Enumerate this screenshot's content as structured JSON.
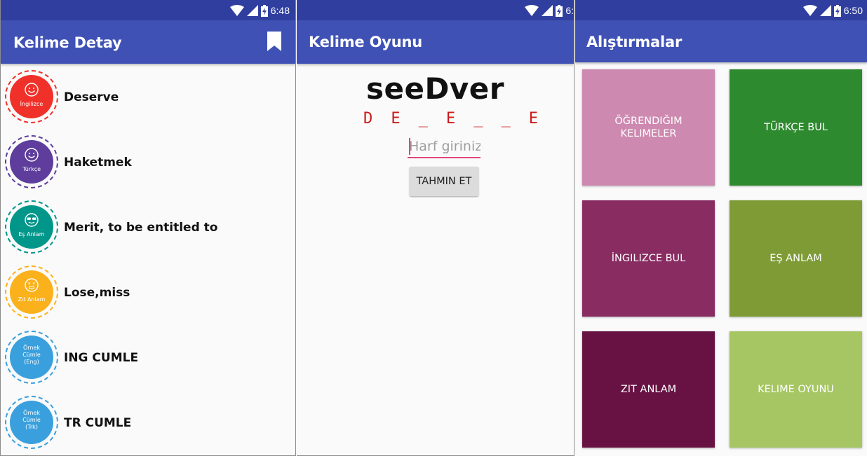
{
  "screens": {
    "detail": {
      "status_time": "6:48",
      "title": "Kelime Detay",
      "rows": [
        {
          "badge": "İngilizce",
          "text": "Deserve",
          "color": "#f0312a",
          "ring": "#f0312a"
        },
        {
          "badge": "Türkçe",
          "text": "Haketmek",
          "color": "#5e3d9c",
          "ring": "#5e3d9c"
        },
        {
          "badge": "Eş Anlam",
          "text": "Merit, to be entitled to",
          "color": "#00968a",
          "ring": "#00968a"
        },
        {
          "badge": "Zıt Anlam",
          "text": "Lose,miss",
          "color": "#fbb11b",
          "ring": "#fbb11b"
        },
        {
          "badge_lines": [
            "Örnek",
            "Cümle",
            "(Eng)"
          ],
          "text": "ING CUMLE",
          "color": "#3aa0dd",
          "ring": "#3aa0dd"
        },
        {
          "badge_lines": [
            "Örnek",
            "Cümle",
            "(Trk)"
          ],
          "text": "TR CUMLE",
          "color": "#3aa0dd",
          "ring": "#3aa0dd"
        }
      ]
    },
    "game": {
      "status_time": "6:",
      "title": "Kelime Oyunu",
      "scrambled_word": "seeDver",
      "letters": [
        "D",
        "E",
        "_",
        "E",
        "_",
        "_",
        "E"
      ],
      "input_placeholder": "Harf giriniz.",
      "button_label": "TAHMIN ET"
    },
    "exercises": {
      "status_time": "6:50",
      "title": "Alıştırmalar",
      "tiles": [
        {
          "label": "ÖĞRENDIĞIM\nKELIMELER",
          "color": "#ce89b0"
        },
        {
          "label": "TÜRKÇE BUL",
          "color": "#2e8a2f"
        },
        {
          "label": "İNGILIZCE BUL",
          "color": "#882c61"
        },
        {
          "label": "EŞ ANLAM",
          "color": "#7e9b36"
        },
        {
          "label": "ZIT ANLAM",
          "color": "#671242"
        },
        {
          "label": "KELIME OYUNU",
          "color": "#a5c662"
        }
      ]
    }
  },
  "colors": {
    "status_bar": "#303f9f",
    "app_bar": "#3f51b5"
  },
  "icons": {
    "status": [
      "wifi-icon",
      "signal-icon",
      "battery-charging-icon"
    ],
    "bookmark": "bookmark-icon"
  }
}
